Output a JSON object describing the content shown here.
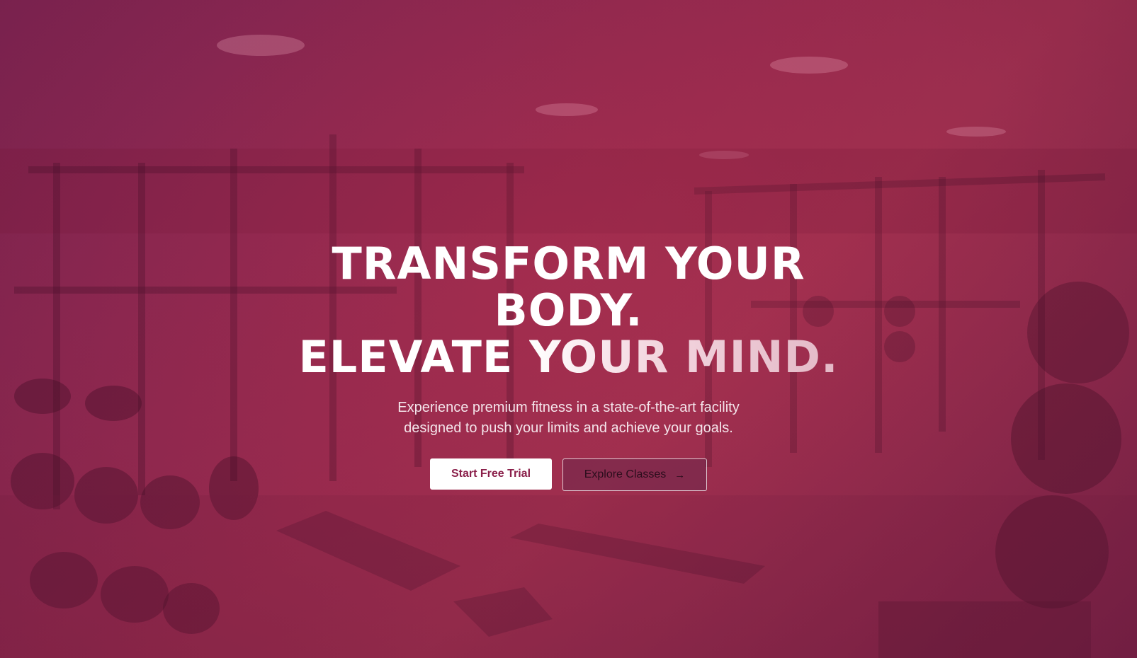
{
  "hero": {
    "title_line1": "TRANSFORM YOUR",
    "title_line2": "BODY.",
    "title_line3_a": "ELEVATE ",
    "title_line3_b": "YOUR MIND.",
    "subtitle_line1": "Experience premium fitness in a state-of-the-art facility",
    "subtitle_line2": "designed to push your limits and achieve your goals.",
    "primary_button_label": "Start Free Trial",
    "secondary_button_label": "Explore Classes",
    "secondary_button_icon": "arrow-right-icon",
    "arrow_glyph": "→"
  },
  "colors": {
    "background": "#8e2650",
    "primary_button_bg": "#ffffff",
    "primary_button_text": "#8a1f4a",
    "text": "#ffffff"
  }
}
